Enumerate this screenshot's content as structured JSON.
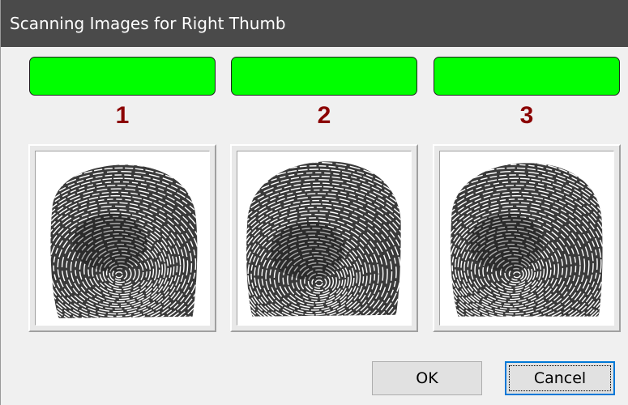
{
  "window": {
    "title": "Scanning Images for Right Thumb"
  },
  "scans": [
    {
      "number": "1",
      "status_color": "#00ff00",
      "image": "fingerprint-image"
    },
    {
      "number": "2",
      "status_color": "#00ff00",
      "image": "fingerprint-image"
    },
    {
      "number": "3",
      "status_color": "#00ff00",
      "image": "fingerprint-image"
    }
  ],
  "colors": {
    "title_bar": "#4a4a4a",
    "status_ok": "#00ff00",
    "scan_number": "#8b0000",
    "default_button_border": "#0078d7"
  },
  "buttons": {
    "ok_label": "OK",
    "cancel_label": "Cancel"
  }
}
